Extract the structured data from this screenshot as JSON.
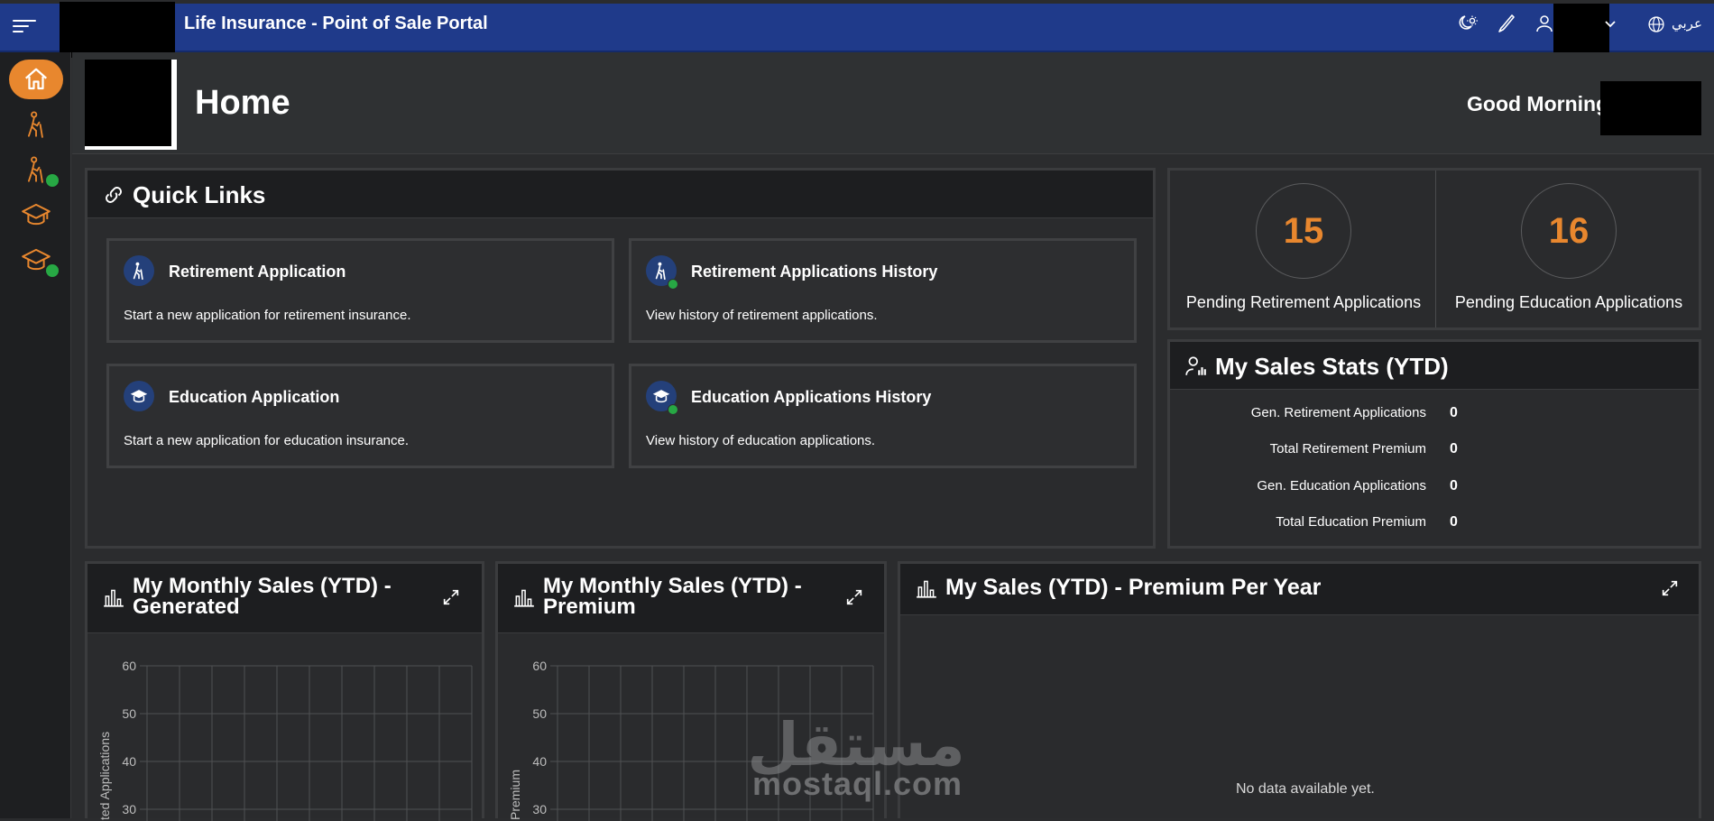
{
  "header": {
    "title": "Life Insurance - Point of Sale Portal",
    "language_label": "عربي"
  },
  "page": {
    "title": "Home",
    "greeting": "Good Morning,"
  },
  "quick_links": {
    "title": "Quick Links",
    "cards": [
      {
        "title": "Retirement Application",
        "desc": "Start a new application for retirement insurance.",
        "icon": "retirement-icon"
      },
      {
        "title": "Retirement Applications History",
        "desc": "View history of retirement applications.",
        "icon": "retirement-history-icon"
      },
      {
        "title": "Education Application",
        "desc": "Start a new application for education insurance.",
        "icon": "graduation-cap-icon"
      },
      {
        "title": "Education Applications History",
        "desc": "View history of education applications.",
        "icon": "education-history-icon"
      }
    ]
  },
  "counters": [
    {
      "value": "15",
      "label": "Pending Retirement Applications"
    },
    {
      "value": "16",
      "label": "Pending Education Applications"
    }
  ],
  "sales_stats": {
    "title": "My Sales Stats (YTD)",
    "rows": [
      {
        "label": "Gen. Retirement Applications",
        "value": "0"
      },
      {
        "label": "Total Retirement Premium",
        "value": "0"
      },
      {
        "label": "Gen. Education Applications",
        "value": "0"
      },
      {
        "label": "Total Education Premium",
        "value": "0"
      }
    ]
  },
  "charts": {
    "generated_title_line1": "My Monthly Sales (YTD) -",
    "generated_title_line2": "Generated",
    "premium_title_line1": "My Monthly Sales (YTD) -",
    "premium_title_line2": "Premium",
    "per_year_title": "My Sales (YTD) - Premium Per Year",
    "no_data": "No data available yet."
  },
  "watermark": {
    "arabic": "مستقل",
    "latin": "mostaql.com"
  },
  "colors": {
    "topbar": "#1f3a8a",
    "accent": "#e8872e",
    "success": "#27a844",
    "background": "#2b2c2e"
  },
  "chart_data": [
    {
      "type": "line",
      "title": "My Monthly Sales (YTD) - Generated",
      "ylabel": "ted Applications",
      "yticks": [
        30,
        40,
        50,
        60
      ],
      "ylim": [
        0,
        60
      ],
      "grid": true,
      "series": []
    },
    {
      "type": "line",
      "title": "My Monthly Sales (YTD) - Premium",
      "ylabel": "Premium",
      "yticks": [
        30,
        40,
        50,
        60
      ],
      "ylim": [
        0,
        60
      ],
      "grid": true,
      "series": []
    },
    {
      "type": "bar",
      "title": "My Sales (YTD) - Premium Per Year",
      "series": []
    }
  ]
}
